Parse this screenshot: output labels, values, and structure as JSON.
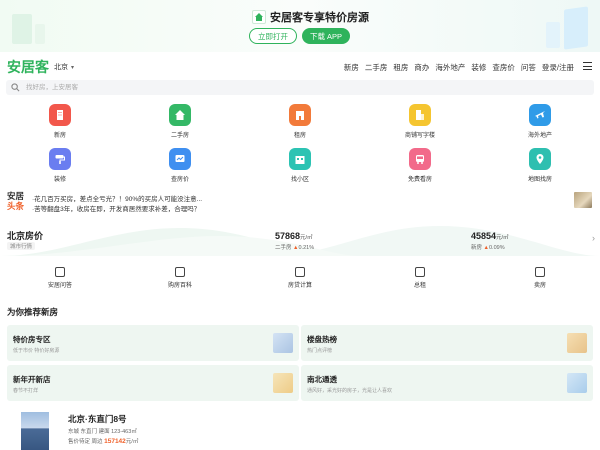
{
  "promo": {
    "title": "安居客专享特价房源",
    "open_label": "立即打开",
    "download_label": "下载 APP"
  },
  "header": {
    "logo": "安居客",
    "city": "北京",
    "nav": [
      "新房",
      "二手房",
      "租房",
      "商办",
      "海外地产",
      "装修",
      "查房价",
      "问答",
      "登录/注册"
    ]
  },
  "search": {
    "placeholder": "找好房，上安居客"
  },
  "categories": [
    {
      "label": "新房",
      "icon": "building-icon",
      "color": "#f2574b"
    },
    {
      "label": "二手房",
      "icon": "house-icon",
      "color": "#34b866"
    },
    {
      "label": "租房",
      "icon": "key-building-icon",
      "color": "#f27a3a"
    },
    {
      "label": "商铺写字楼",
      "icon": "office-icon",
      "color": "#f5c530"
    },
    {
      "label": "海外地产",
      "icon": "airplane-icon",
      "color": "#2f9be8"
    },
    {
      "label": "装修",
      "icon": "paint-roller-icon",
      "color": "#6a7df0"
    },
    {
      "label": "查房价",
      "icon": "price-chart-icon",
      "color": "#3f8ff0"
    },
    {
      "label": "找小区",
      "icon": "community-icon",
      "color": "#2cc3b3"
    },
    {
      "label": "免费看房",
      "icon": "bus-icon",
      "color": "#f26a8a"
    },
    {
      "label": "地图找房",
      "icon": "map-pin-icon",
      "color": "#2ebfb0"
    }
  ],
  "news": {
    "brand_top": "安居",
    "brand_bottom": "头条",
    "line1": "·花几百万买房，差点全亏光？！90%的买房人可能没注意...",
    "line2": "·苦等翻盘3年，收房在即，开发商居然要求补差，合理吗？"
  },
  "prices": {
    "title": "北京房价",
    "tag": "城市行情",
    "second_hand_value": "57868",
    "second_hand_unit": "元/㎡",
    "second_hand_label": "二手房",
    "second_hand_change": "0.21%",
    "new_value": "45854",
    "new_unit": "元/㎡",
    "new_label": "新房",
    "new_change": "0.09%"
  },
  "tools": [
    "安居问答",
    "购房百科",
    "房贷计算",
    "总租",
    "卖房"
  ],
  "recommend": {
    "title": "为你推荐新房",
    "cards": [
      {
        "title": "特价房专区",
        "sub": "低于市价 特价好房源"
      },
      {
        "title": "楼盘热榜",
        "sub": "热门点评榜"
      },
      {
        "title": "新年开新店",
        "sub": "春节不打烊"
      },
      {
        "title": "南北通透",
        "sub": "通风好，采光好的房子，光是让人喜欢"
      }
    ]
  },
  "listing": {
    "title": "北京·东直门8号",
    "location": "东城 东直门",
    "area": "建面 123-463㎡",
    "price_label": "售价待定",
    "near_label": "周边",
    "price_value": "157142",
    "price_unit": "元/㎡"
  }
}
